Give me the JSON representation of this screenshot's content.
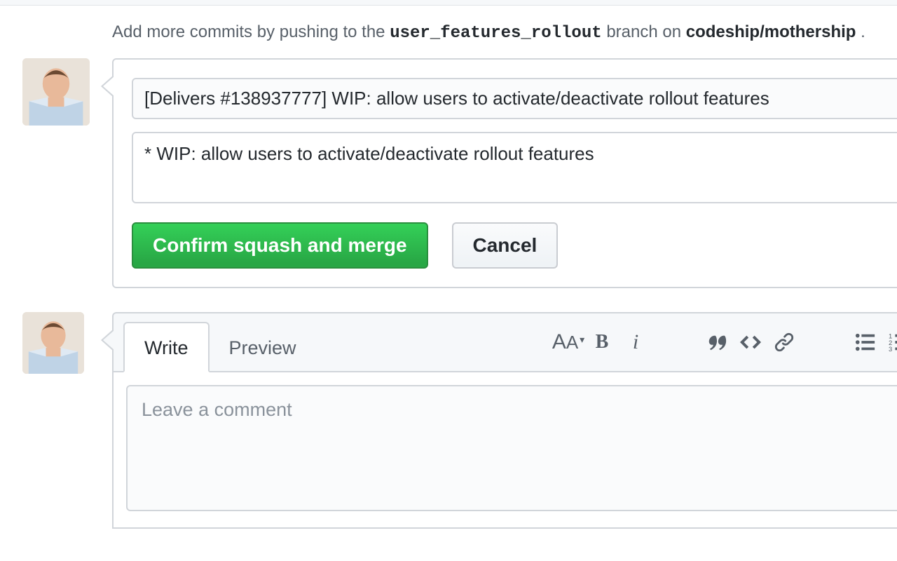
{
  "push_hint": {
    "prefix": "Add more commits by pushing to the ",
    "branch": "user_features_rollout",
    "mid": " branch on ",
    "repo": "codeship/mothership",
    "suffix": "."
  },
  "merge": {
    "title_value": "[Delivers #138937777] WIP: allow users to activate/deactivate rollout features",
    "body_value": "* WIP: allow users to activate/deactivate rollout features",
    "confirm_label": "Confirm squash and merge",
    "cancel_label": "Cancel"
  },
  "comment": {
    "tab_write": "Write",
    "tab_preview": "Preview",
    "placeholder": "Leave a comment"
  }
}
